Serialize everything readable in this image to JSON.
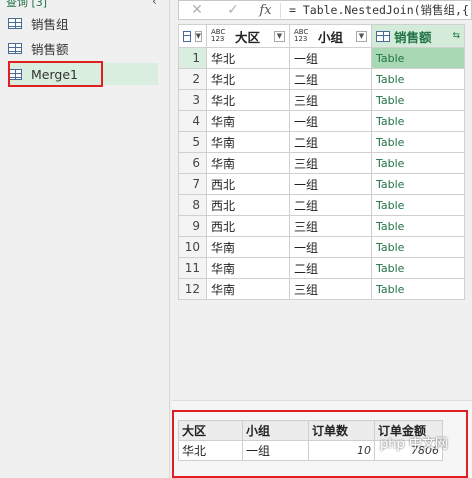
{
  "queries": {
    "header": "查询 [3]",
    "collapse": "‹",
    "items": [
      {
        "label": "销售组"
      },
      {
        "label": "销售额"
      },
      {
        "label": "Merge1"
      }
    ]
  },
  "formula_bar": {
    "cancel": "✕",
    "confirm": "✓",
    "fx": "fx",
    "formula": "= Table.NestedJoin(销售组,{"
  },
  "grid": {
    "columns": [
      {
        "type": "ABC\n123",
        "label": "大区"
      },
      {
        "type": "ABC\n123",
        "label": "小组"
      },
      {
        "label": "销售额"
      }
    ],
    "rows": [
      {
        "n": "1",
        "region": "华北",
        "group": "一组",
        "sales": "Table"
      },
      {
        "n": "2",
        "region": "华北",
        "group": "二组",
        "sales": "Table"
      },
      {
        "n": "3",
        "region": "华北",
        "group": "三组",
        "sales": "Table"
      },
      {
        "n": "4",
        "region": "华南",
        "group": "一组",
        "sales": "Table"
      },
      {
        "n": "5",
        "region": "华南",
        "group": "二组",
        "sales": "Table"
      },
      {
        "n": "6",
        "region": "华南",
        "group": "三组",
        "sales": "Table"
      },
      {
        "n": "7",
        "region": "西北",
        "group": "一组",
        "sales": "Table"
      },
      {
        "n": "8",
        "region": "西北",
        "group": "二组",
        "sales": "Table"
      },
      {
        "n": "9",
        "region": "西北",
        "group": "三组",
        "sales": "Table"
      },
      {
        "n": "10",
        "region": "华南",
        "group": "一组",
        "sales": "Table"
      },
      {
        "n": "11",
        "region": "华南",
        "group": "二组",
        "sales": "Table"
      },
      {
        "n": "12",
        "region": "华南",
        "group": "三组",
        "sales": "Table"
      }
    ]
  },
  "preview": {
    "headers": [
      "大区",
      "小组",
      "订单数",
      "订单金额"
    ],
    "row": [
      "华北",
      "一组",
      "10",
      "7806"
    ]
  },
  "watermark": "php 中文网",
  "colors": {
    "accent": "#217346",
    "selection": "#a8d8b4",
    "highlight_box": "#e02020"
  }
}
